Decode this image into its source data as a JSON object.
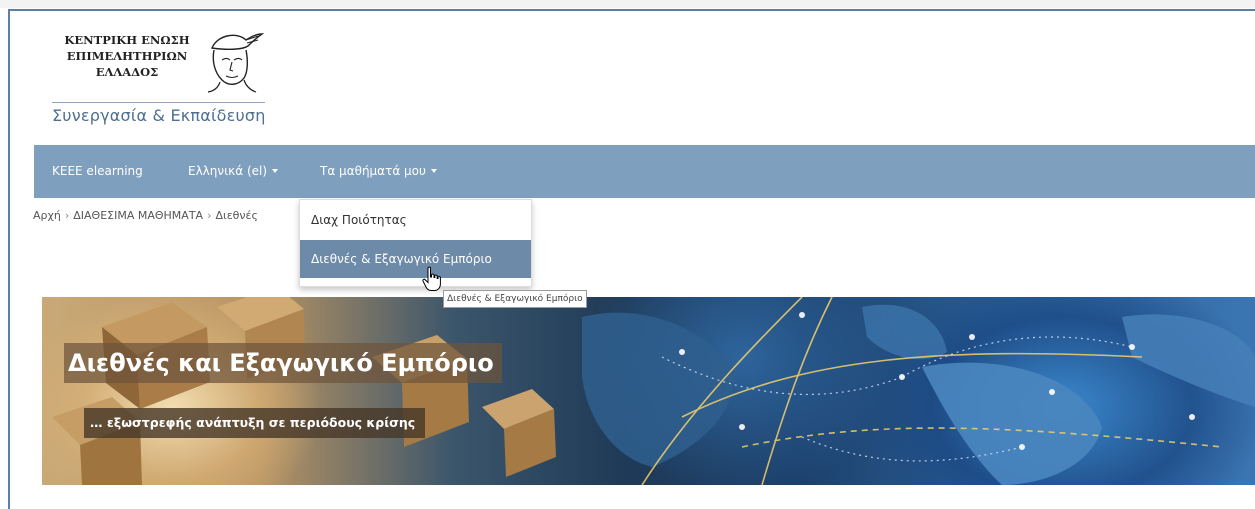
{
  "logo": {
    "line1": "ΚΕΝΤΡΙΚΗ ΕΝΩΣΗ",
    "line2": "ΕΠΙΜΕΛΗΤΗΡΙΩΝ",
    "line3": "ΕΛΛΑΔΟΣ",
    "tagline": "Συνεργασία & Εκπαίδευση",
    "emblem_icon": "hermes-head-icon"
  },
  "navbar": {
    "site_link": "KEEE elearning",
    "language": "Ελληνικά (el)",
    "my_courses": "Τα μαθήματά μου"
  },
  "breadcrumb": {
    "items": [
      "Αρχή",
      "ΔΙΑΘΕΣΙΜΑ ΜΑΘΗΜΑΤΑ",
      "Διεθνές"
    ]
  },
  "dropdown": {
    "items": [
      "Διαχ Ποιότητας",
      "Διεθνές & Εξαγωγικό Εμπόριο"
    ],
    "tooltip": "Διεθνές & Εξαγωγικό Εμπόριο"
  },
  "banner": {
    "title": "Διεθνές και Εξαγωγικό Εμπόριο",
    "subtitle": "… εξωστρεφής ανάπτυξη σε περιόδους κρίσης"
  },
  "colors": {
    "navbar": "#7f9fbf",
    "dropdown_active": "#6d8aa9",
    "frame_border": "#5d7fa6",
    "tagline": "#4d6f91"
  }
}
